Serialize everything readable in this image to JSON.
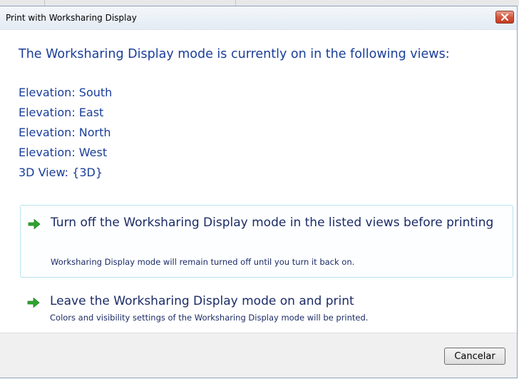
{
  "dialog": {
    "title": "Print with Worksharing Display",
    "heading": "The Worksharing Display mode is currently on in the following views:",
    "views": [
      "Elevation: South",
      "Elevation: East",
      "Elevation: North",
      "Elevation: West",
      "3D View: {3D}"
    ],
    "options": [
      {
        "icon": "green-arrow-icon",
        "title": "Turn off the Worksharing Display mode in the listed views before printing",
        "description": "Worksharing Display mode will remain turned off until you turn it back on."
      },
      {
        "icon": "green-arrow-icon",
        "title": "Leave the Worksharing Display mode on and print",
        "description": "Colors and visibility settings of the Worksharing Display mode will be printed."
      }
    ],
    "cancel_label": "Cancelar",
    "close_icon": "close-icon"
  },
  "colors": {
    "heading_text": "#1a3e9a",
    "option_text": "#1b2b66",
    "arrow_green": "#2fa52f",
    "hover_border": "#b7e4ef",
    "close_red": "#c23b1f"
  }
}
